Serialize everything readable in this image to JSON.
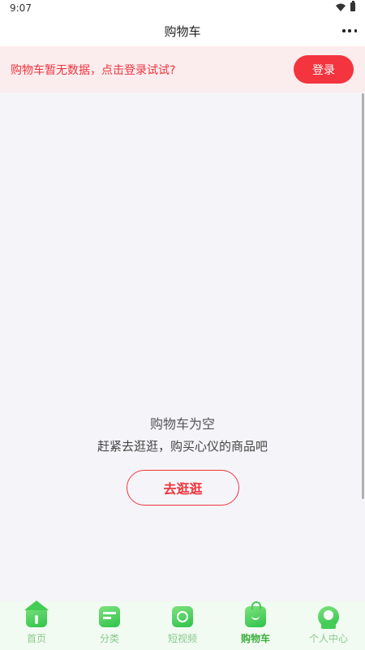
{
  "status_bar": {
    "time": "9:07"
  },
  "header": {
    "title": "购物车"
  },
  "login_banner": {
    "message": "购物车暂无数据，点击登录试试?",
    "button_label": "登录"
  },
  "empty_state": {
    "title": "购物车为空",
    "subtitle": "赶紧去逛逛，购买心仪的商品吧",
    "button_label": "去逛逛"
  },
  "tab_bar": {
    "items": [
      {
        "label": "首页",
        "icon": "home-icon",
        "active": false
      },
      {
        "label": "分类",
        "icon": "category-icon",
        "active": false
      },
      {
        "label": "短视频",
        "icon": "video-icon",
        "active": false
      },
      {
        "label": "购物车",
        "icon": "cart-icon",
        "active": true
      },
      {
        "label": "个人中心",
        "icon": "profile-icon",
        "active": false
      }
    ]
  },
  "colors": {
    "accent_red": "#f4343e",
    "tab_green": "#3fae3f",
    "banner_bg": "#fbecee"
  }
}
